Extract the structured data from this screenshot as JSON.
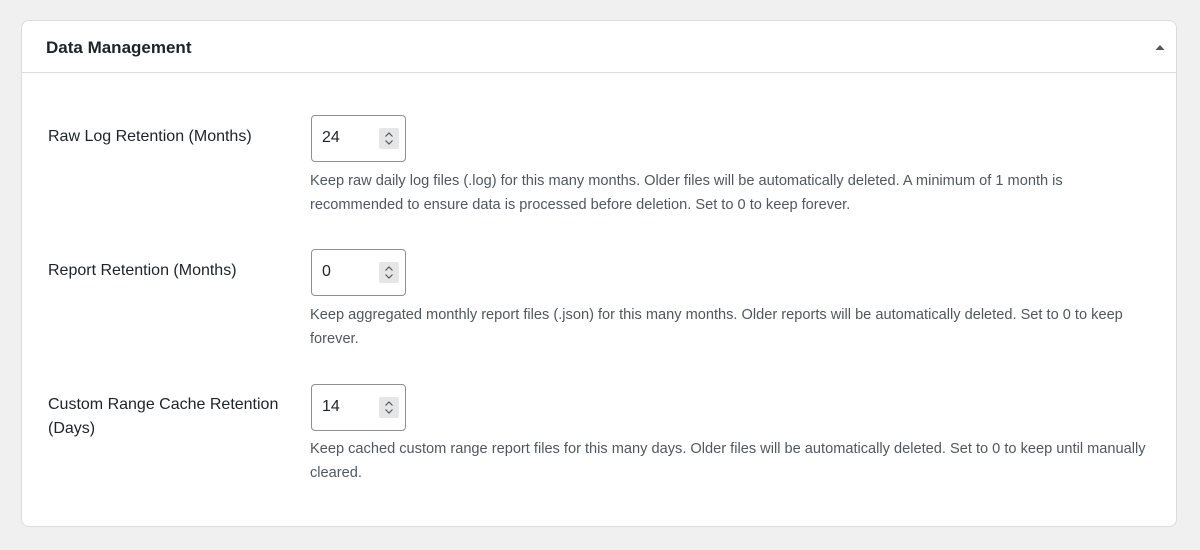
{
  "section": {
    "title": "Data Management",
    "toggle_icon": "caret-up-icon"
  },
  "fields": [
    {
      "label": "Raw Log Retention (Months)",
      "value": "24",
      "description": "Keep raw daily log files (.log) for this many months. Older files will be automatically deleted. A minimum of 1 month is recommended to ensure data is processed before deletion. Set to 0 to keep forever."
    },
    {
      "label": "Report Retention (Months)",
      "value": "0",
      "description": "Keep aggregated monthly report files (.json) for this many months. Older reports will be automatically deleted. Set to 0 to keep forever."
    },
    {
      "label": "Custom Range Cache Retention (Days)",
      "value": "14",
      "description": "Keep cached custom range report files for this many days. Older files will be automatically deleted. Set to 0 to keep until manually cleared."
    }
  ],
  "colors": {
    "background": "#f0f0f1",
    "panel": "#ffffff",
    "border": "#dcdcde",
    "text": "#1d2327",
    "description": "#50575e"
  }
}
